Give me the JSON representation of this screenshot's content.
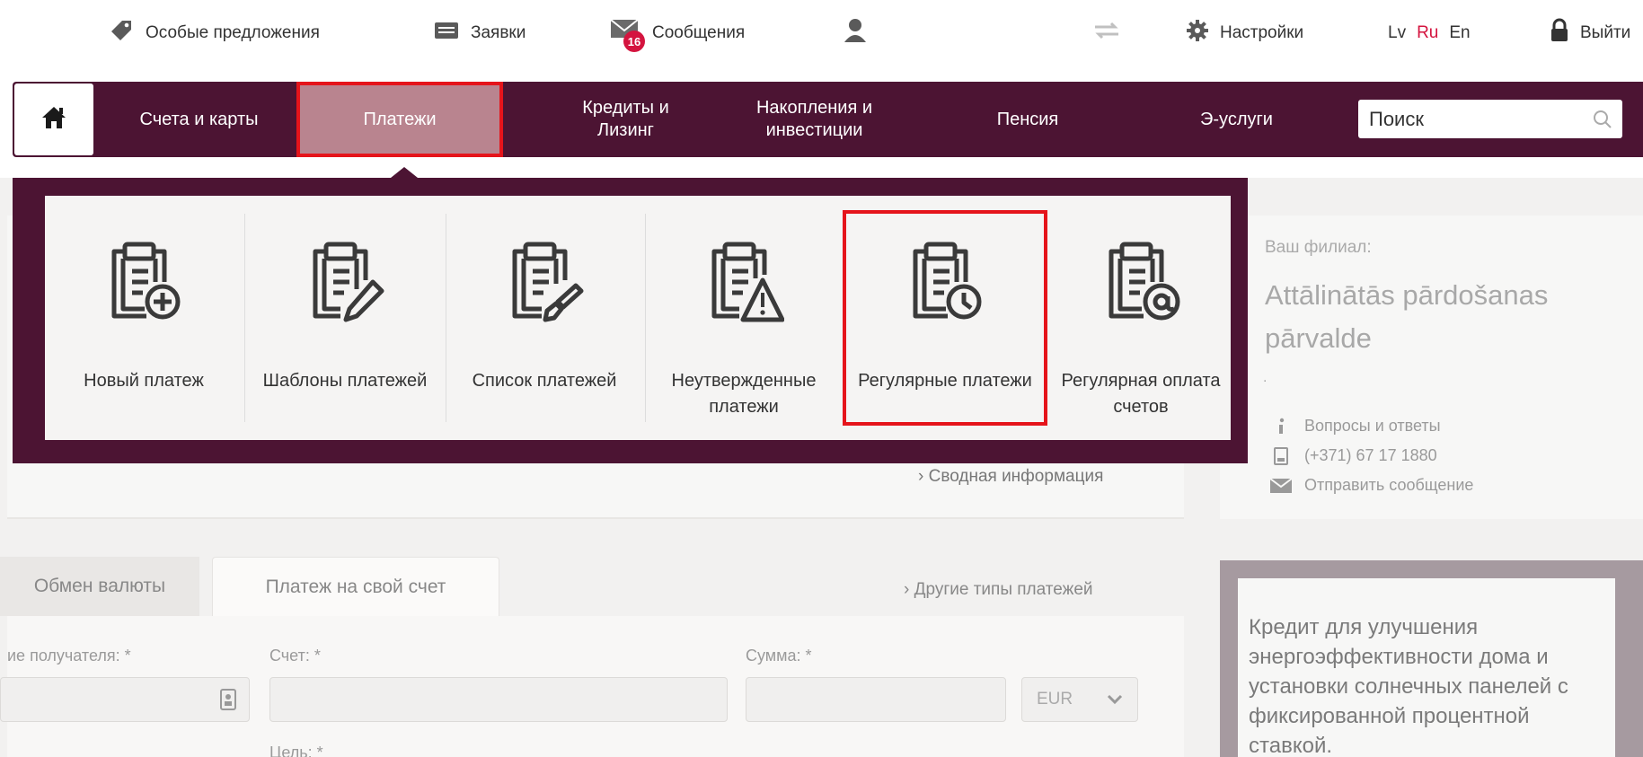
{
  "topbar": {
    "offers": "Особые предложения",
    "applications": "Заявки",
    "messages": "Сообщения",
    "messages_badge": "16",
    "settings": "Настройки",
    "lang": [
      "Lv",
      "Ru",
      "En"
    ],
    "lang_active": "Ru",
    "logout": "Выйти"
  },
  "nav": {
    "items": [
      "Счета и карты",
      "Платежи",
      "Кредиты и Лизинг",
      "Накопления и инвестиции",
      "Пенсия",
      "Э-услуги"
    ],
    "active": "Платежи",
    "search_placeholder": "Поиск"
  },
  "dropdown": {
    "items": [
      {
        "label": "Новый платеж",
        "icon": "clipboard-plus-icon"
      },
      {
        "label": "Шаблоны платежей",
        "icon": "clipboard-pencil-icon"
      },
      {
        "label": "Список платежей",
        "icon": "clipboard-stamp-icon"
      },
      {
        "label": "Неутвержденные платежи",
        "icon": "clipboard-warning-icon"
      },
      {
        "label": "Регулярные платежи",
        "icon": "clipboard-clock-icon"
      },
      {
        "label": "Регулярная оплата счетов",
        "icon": "clipboard-at-icon"
      }
    ],
    "highlighted": "Регулярные платежи"
  },
  "summary_link": "Сводная информация",
  "tabs": [
    "Обмен валюты",
    "Платеж на свой счет"
  ],
  "other_types": "Другие типы платежей",
  "form": {
    "recipient_label": "ие получателя: *",
    "account_label": "Счет: *",
    "amount_label": "Сумма: *",
    "currency": "EUR",
    "purpose_label": "Цель: *"
  },
  "branch": {
    "label": "Ваш филиал:",
    "name": "Attālinātās pārdošanas pārvalde",
    "dot": ".",
    "faq": "Вопросы и ответы",
    "phone": "(+371) 67 17 1880",
    "send_message": "Отправить сообщение"
  },
  "promo": "Кредит для улучшения энергоэффективности дома и установки солнечных панелей с фиксированной процентной ставкой."
}
